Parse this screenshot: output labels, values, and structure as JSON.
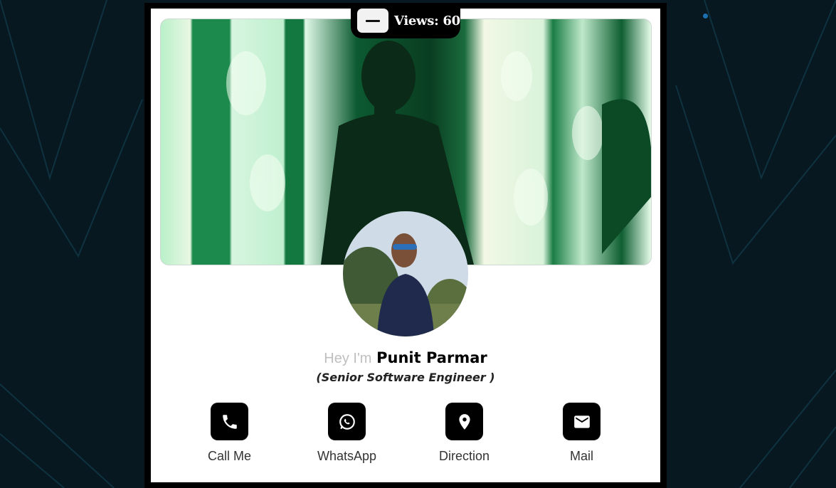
{
  "header": {
    "views_label": "Views: 60"
  },
  "profile": {
    "greeting_prefix": "Hey I'm",
    "name": "Punit Parmar",
    "role": "(Senior Software Engineer )"
  },
  "actions": [
    {
      "label": "Call Me",
      "icon": "phone-icon"
    },
    {
      "label": "WhatsApp",
      "icon": "whatsapp-icon"
    },
    {
      "label": "Direction",
      "icon": "location-pin-icon"
    },
    {
      "label": "Mail",
      "icon": "mail-icon"
    }
  ],
  "colors": {
    "background": "#071820",
    "card": "#ffffff",
    "accent": "#000000"
  }
}
